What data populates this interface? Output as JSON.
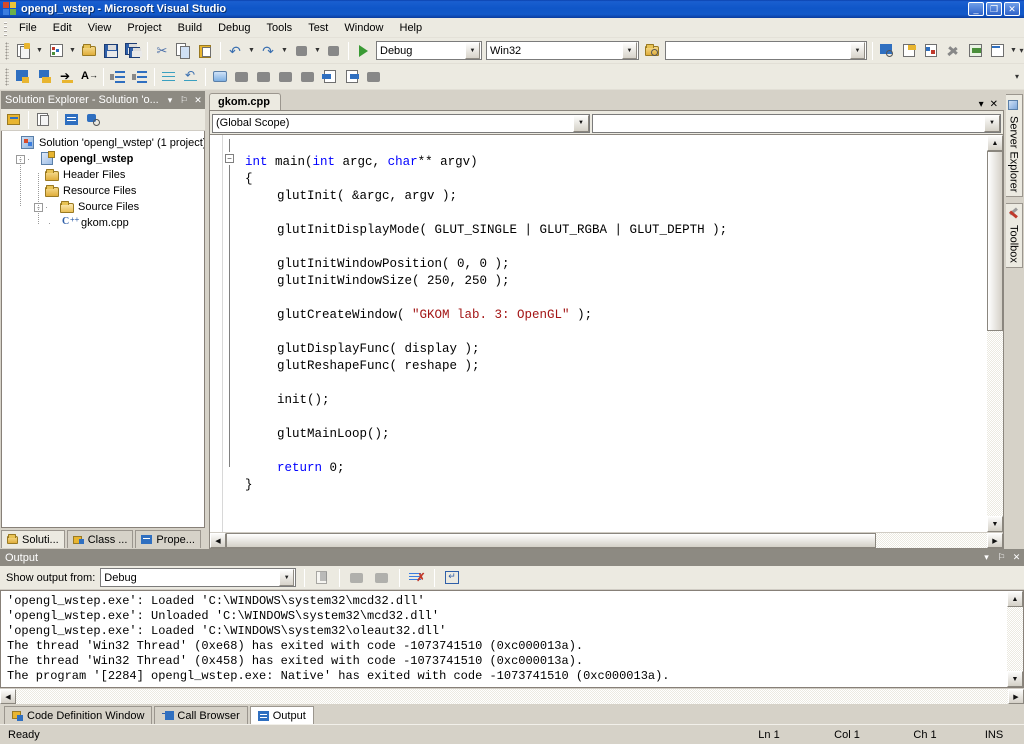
{
  "window": {
    "title": "opengl_wstep - Microsoft Visual Studio",
    "icon": "visual-studio-icon",
    "minimize": "_",
    "maximize": "❐",
    "close": "✕"
  },
  "menubar": {
    "items": [
      {
        "label": "File"
      },
      {
        "label": "Edit"
      },
      {
        "label": "View"
      },
      {
        "label": "Project"
      },
      {
        "label": "Build"
      },
      {
        "label": "Debug"
      },
      {
        "label": "Tools"
      },
      {
        "label": "Test"
      },
      {
        "label": "Window"
      },
      {
        "label": "Help"
      }
    ]
  },
  "toolbar": {
    "configuration": "Debug",
    "platform": "Win32",
    "find_box": "",
    "standard_icons": [
      "new-project-icon",
      "new-item-icon",
      "open-file-icon",
      "save-icon",
      "save-all-icon",
      "cut-icon",
      "copy-icon",
      "paste-icon",
      "undo-icon",
      "redo-icon",
      "navigate-backward-icon",
      "navigate-forward-icon",
      "start-debug-icon"
    ],
    "right_icons": [
      "find-in-files-icon",
      "properties-window-icon",
      "object-browser-icon",
      "toolbox-icon",
      "start-icon",
      "command-window-icon"
    ],
    "text_editor_icons": [
      "display-members-icon",
      "find-symbol-icon",
      "mark-icon",
      "comment-icon",
      "decrease-indent-icon",
      "increase-indent-icon",
      "comment-block-icon",
      "uncomment-block-icon",
      "bookmark-icon",
      "previous-bookmark-icon",
      "next-bookmark-icon",
      "prev-bookmark-folder-icon",
      "next-bookmark-folder-icon",
      "step-into-icon",
      "step-over-icon",
      "clear-bookmarks-icon"
    ],
    "overflow": "▾"
  },
  "solution_explorer": {
    "title": "Solution Explorer - Solution 'o...",
    "title_buttons": [
      "▾",
      "⚐",
      "✕"
    ],
    "toolbar_icons": [
      "properties-icon",
      "show-all-files-icon",
      "view-code-icon",
      "refresh-icon"
    ],
    "tree": [
      {
        "label": "Solution 'opengl_wstep' (1 project)",
        "icon": "solution-icon",
        "depth": 0,
        "expander": "",
        "bold": false
      },
      {
        "label": "opengl_wstep",
        "icon": "project-icon",
        "depth": 1,
        "expander": "-",
        "bold": true
      },
      {
        "label": "Header Files",
        "icon": "folder-icon",
        "depth": 2,
        "expander": "",
        "bold": false
      },
      {
        "label": "Resource Files",
        "icon": "folder-icon",
        "depth": 2,
        "expander": "",
        "bold": false
      },
      {
        "label": "Source Files",
        "icon": "folder-open-icon",
        "depth": 2,
        "expander": "-",
        "bold": false
      },
      {
        "label": "gkom.cpp",
        "icon": "cpp-file-icon",
        "depth": 3,
        "expander": "",
        "bold": false
      }
    ],
    "tabs": [
      {
        "label": "Soluti...",
        "icon": "solution-explorer-icon",
        "active": true
      },
      {
        "label": "Class ...",
        "icon": "class-view-icon",
        "active": false
      },
      {
        "label": "Prope...",
        "icon": "properties-icon",
        "active": false
      }
    ]
  },
  "editor": {
    "document_tab": "gkom.cpp",
    "tab_buttons": [
      "▾",
      "✕"
    ],
    "scope_combo": "(Global Scope)",
    "member_combo": "",
    "code_lines": [
      {
        "indent": 0,
        "segments": [
          {
            "t": "",
            "c": ""
          }
        ]
      },
      {
        "indent": 0,
        "segments": [
          {
            "t": "int",
            "c": "kw"
          },
          {
            "t": " main(",
            "c": ""
          },
          {
            "t": "int",
            "c": "kw"
          },
          {
            "t": " argc, ",
            "c": ""
          },
          {
            "t": "char",
            "c": "kw"
          },
          {
            "t": "** argv)",
            "c": ""
          }
        ]
      },
      {
        "indent": 0,
        "segments": [
          {
            "t": "{",
            "c": ""
          }
        ]
      },
      {
        "indent": 4,
        "segments": [
          {
            "t": "glutInit( &argc, argv );",
            "c": ""
          }
        ]
      },
      {
        "indent": 0,
        "segments": [
          {
            "t": "",
            "c": ""
          }
        ]
      },
      {
        "indent": 4,
        "segments": [
          {
            "t": "glutInitDisplayMode( GLUT_SINGLE | GLUT_RGBA | GLUT_DEPTH );",
            "c": ""
          }
        ]
      },
      {
        "indent": 0,
        "segments": [
          {
            "t": "",
            "c": ""
          }
        ]
      },
      {
        "indent": 4,
        "segments": [
          {
            "t": "glutInitWindowPosition( 0, 0 );",
            "c": ""
          }
        ]
      },
      {
        "indent": 4,
        "segments": [
          {
            "t": "glutInitWindowSize( 250, 250 );",
            "c": ""
          }
        ]
      },
      {
        "indent": 0,
        "segments": [
          {
            "t": "",
            "c": ""
          }
        ]
      },
      {
        "indent": 4,
        "segments": [
          {
            "t": "glutCreateWindow( ",
            "c": ""
          },
          {
            "t": "\"GKOM lab. 3: OpenGL\"",
            "c": "str"
          },
          {
            "t": " );",
            "c": ""
          }
        ]
      },
      {
        "indent": 0,
        "segments": [
          {
            "t": "",
            "c": ""
          }
        ]
      },
      {
        "indent": 4,
        "segments": [
          {
            "t": "glutDisplayFunc( display );",
            "c": ""
          }
        ]
      },
      {
        "indent": 4,
        "segments": [
          {
            "t": "glutReshapeFunc( reshape );",
            "c": ""
          }
        ]
      },
      {
        "indent": 0,
        "segments": [
          {
            "t": "",
            "c": ""
          }
        ]
      },
      {
        "indent": 4,
        "segments": [
          {
            "t": "init();",
            "c": ""
          }
        ]
      },
      {
        "indent": 0,
        "segments": [
          {
            "t": "",
            "c": ""
          }
        ]
      },
      {
        "indent": 4,
        "segments": [
          {
            "t": "glutMainLoop();",
            "c": ""
          }
        ]
      },
      {
        "indent": 0,
        "segments": [
          {
            "t": "",
            "c": ""
          }
        ]
      },
      {
        "indent": 4,
        "segments": [
          {
            "t": "return",
            "c": "kw"
          },
          {
            "t": " 0;",
            "c": ""
          }
        ]
      },
      {
        "indent": 0,
        "segments": [
          {
            "t": "}",
            "c": ""
          }
        ]
      }
    ]
  },
  "right_rail": {
    "tabs": [
      {
        "label": "Server Explorer",
        "icon": "server-explorer-icon"
      },
      {
        "label": "Toolbox",
        "icon": "toolbox-icon"
      }
    ]
  },
  "output": {
    "title": "Output",
    "title_buttons": [
      "▾",
      "⚐",
      "✕"
    ],
    "show_output_from_label": "Show output from:",
    "show_output_from_value": "Debug",
    "toolbar_icons": [
      "find-message-icon",
      "go-to-previous-icon",
      "go-to-next-icon",
      "clear-all-icon",
      "toggle-word-wrap-icon"
    ],
    "lines": [
      "'opengl_wstep.exe': Loaded 'C:\\WINDOWS\\system32\\mcd32.dll'",
      "'opengl_wstep.exe': Unloaded 'C:\\WINDOWS\\system32\\mcd32.dll'",
      "'opengl_wstep.exe': Loaded 'C:\\WINDOWS\\system32\\oleaut32.dll'",
      "The thread 'Win32 Thread' (0xe68) has exited with code -1073741510 (0xc000013a).",
      "The thread 'Win32 Thread' (0x458) has exited with code -1073741510 (0xc000013a).",
      "The program '[2284] opengl_wstep.exe: Native' has exited with code -1073741510 (0xc000013a)."
    ]
  },
  "bottom_tabs": [
    {
      "label": "Code Definition Window",
      "icon": "code-definition-icon",
      "active": false
    },
    {
      "label": "Call Browser",
      "icon": "call-browser-icon",
      "active": false
    },
    {
      "label": "Output",
      "icon": "output-icon",
      "active": true
    }
  ],
  "statusbar": {
    "ready": "Ready",
    "line": "Ln 1",
    "column": "Col 1",
    "character": "Ch 1",
    "insert_mode": "INS"
  },
  "colors": {
    "title_blue": "#0f56c8",
    "chrome": "#eceae1",
    "panel_title": "#8d8a82",
    "keyword_blue": "#0000ff",
    "string_red": "#a31515"
  }
}
